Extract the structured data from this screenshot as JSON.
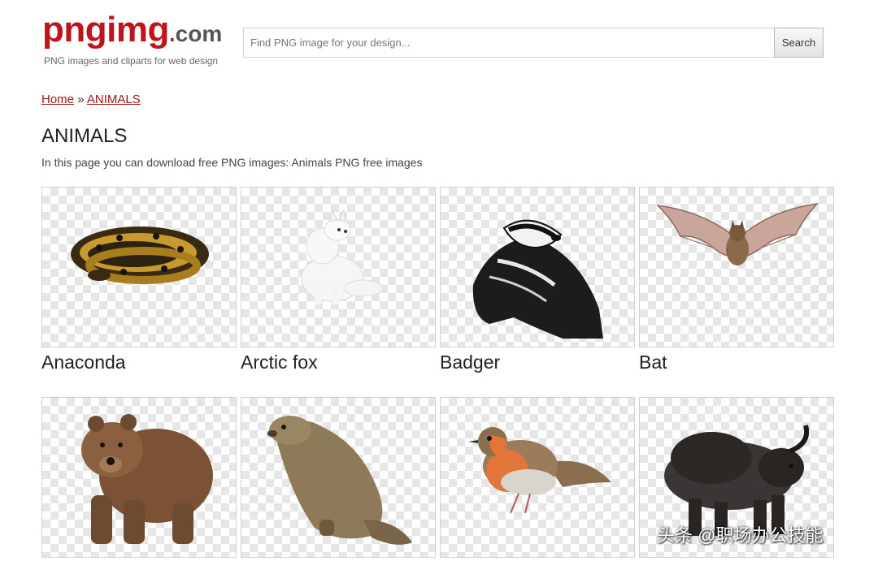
{
  "header": {
    "logo_main": "pngimg",
    "logo_tld": ".com",
    "tagline": "PNG images and cliparts for web design"
  },
  "search": {
    "placeholder": "Find PNG image for your design...",
    "button_label": "Search"
  },
  "breadcrumb": {
    "home": "Home",
    "separator": "»",
    "current": "ANIMALS"
  },
  "page": {
    "title": "ANIMALS",
    "description": "In this page you can download free PNG images: Animals PNG free images"
  },
  "cards": [
    {
      "label": "Anaconda",
      "image": "anaconda"
    },
    {
      "label": "Arctic fox",
      "image": "arctic-fox"
    },
    {
      "label": "Badger",
      "image": "badger"
    },
    {
      "label": "Bat",
      "image": "bat"
    },
    {
      "label": "",
      "image": "brown-bear"
    },
    {
      "label": "",
      "image": "marmot"
    },
    {
      "label": "",
      "image": "robin"
    },
    {
      "label": "",
      "image": "bison"
    }
  ],
  "watermark": "头条 @职场办公技能",
  "colors": {
    "brand_red": "#c0141b",
    "link": "#a31515",
    "checker": "#e6e6e6"
  }
}
